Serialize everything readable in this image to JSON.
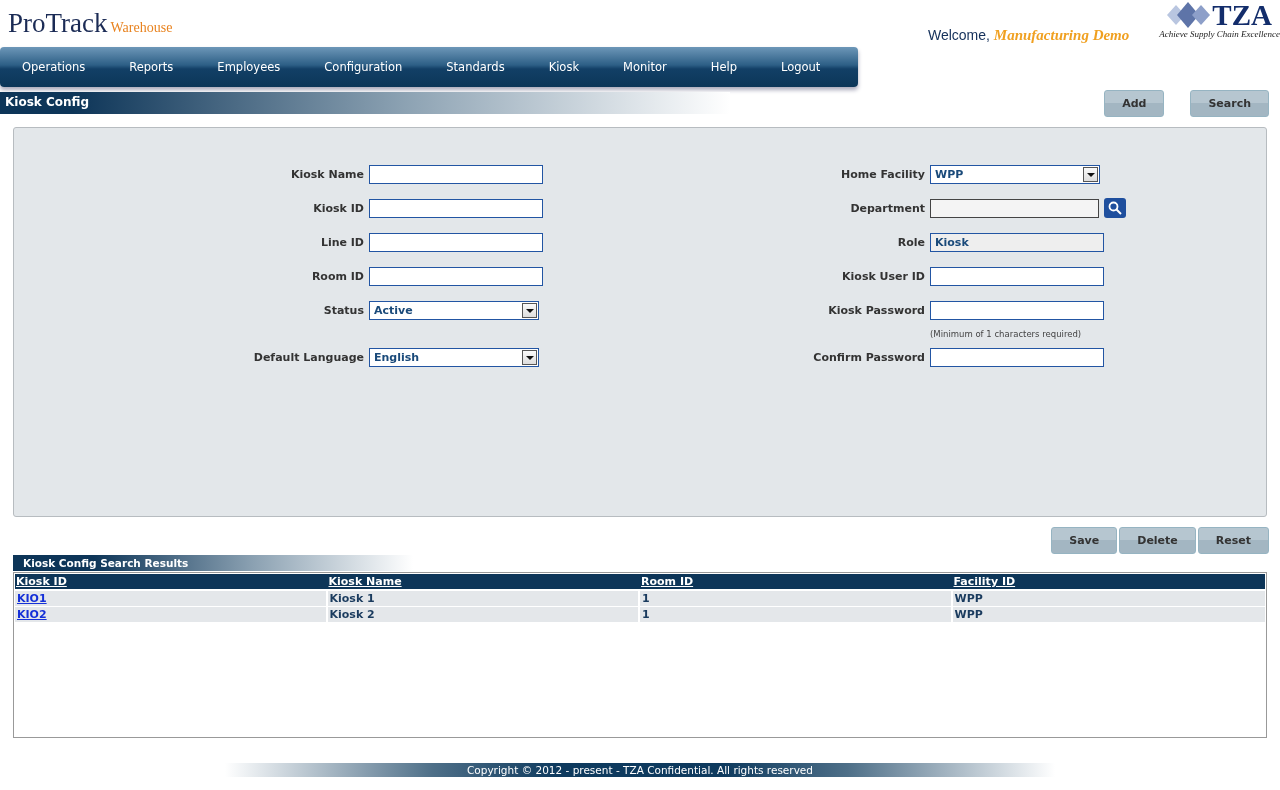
{
  "header": {
    "logo_main": "ProTrack",
    "logo_sub": "Warehouse",
    "welcome": "Welcome,",
    "user": "Manufacturing Demo",
    "brand": "TZA",
    "tagline": "Achieve Supply Chain Excellence"
  },
  "nav": [
    {
      "label": "Operations"
    },
    {
      "label": "Reports"
    },
    {
      "label": "Employees"
    },
    {
      "label": "Configuration"
    },
    {
      "label": "Standards"
    },
    {
      "label": "Kiosk"
    },
    {
      "label": "Monitor"
    },
    {
      "label": "Help"
    },
    {
      "label": "Logout"
    }
  ],
  "page_title": "Kiosk Config",
  "top_buttons": [
    "Add",
    "Search"
  ],
  "form_rows": [
    {
      "left": {
        "label": "Kiosk Name",
        "kind": "text"
      },
      "right": {
        "label": "Home Facility",
        "kind": "select",
        "value": "WPP"
      }
    },
    {
      "left": {
        "label": "Kiosk ID",
        "kind": "text"
      },
      "right": {
        "label": "Department",
        "kind": "lookup"
      }
    },
    {
      "left": {
        "label": "Line ID",
        "kind": "text"
      },
      "right": {
        "label": "Role",
        "kind": "readonly",
        "value": "Kiosk"
      }
    },
    {
      "left": {
        "label": "Room ID",
        "kind": "text"
      },
      "right": {
        "label": "Kiosk User ID",
        "kind": "text"
      }
    },
    {
      "left": {
        "label": "Status",
        "kind": "select",
        "value": "Active"
      },
      "right": {
        "label": "Kiosk Password",
        "kind": "text"
      }
    },
    {
      "right": {
        "kind": "hint",
        "text": "(Minimum of 1 characters required)"
      }
    },
    {
      "left": {
        "label": "Default Language",
        "kind": "select",
        "value": "English"
      },
      "right": {
        "label": "Confirm Password",
        "kind": "text"
      }
    }
  ],
  "action_buttons": [
    "Save",
    "Delete",
    "Reset"
  ],
  "results": {
    "title": "Kiosk Config Search Results",
    "columns": [
      "Kiosk ID",
      "Kiosk Name",
      "Room ID",
      "Facility ID"
    ],
    "rows": [
      [
        "KIO1",
        "Kiosk 1",
        "1",
        "WPP"
      ],
      [
        "KIO2",
        "Kiosk 2",
        "1",
        "WPP"
      ]
    ]
  },
  "footer": "Copyright © 2012 - present - TZA Confidential. All rights reserved"
}
